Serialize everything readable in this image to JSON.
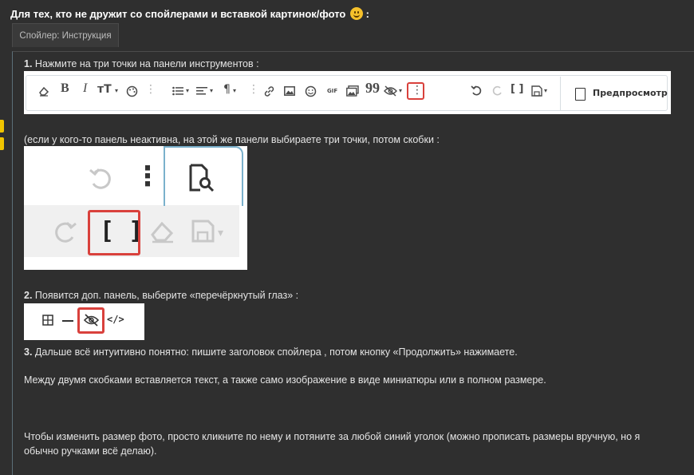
{
  "header": {
    "title": "Для тех, кто не дружит со спойлерами и вставкой картинок/фото",
    "title_suffix": ":"
  },
  "spoiler": {
    "label": "Спойлер: Инструкция"
  },
  "steps": {
    "step1_num": "1.",
    "step1_text": "Нажмите на три точки на панели инструментов :",
    "note_inactive": "(если у кого-то панель неактивна, на этой же панели выбираете три точки, потом скобки :",
    "step2_num": "2.",
    "step2_text": "Появится доп. панель, выберите «перечёркнутый глаз» :",
    "step3_num": "3.",
    "step3_text": "Дальше всё интуитивно понятно: пишите заголовок спойлера , потом кнопку «Продолжить» нажимаете.",
    "between_text": "Между двумя скобками вставляется текст, а также само изображение в виде миниатюры или в полном размере.",
    "resize_line1": "Чтобы изменить размер фото, просто кликните по нему и потяните за любой синий уголок (можно прописать размеры вручную, но я",
    "resize_line2": "обычно ручками всё делаю)."
  },
  "toolbar": {
    "bold": "B",
    "italic": "I",
    "text_size": "тT",
    "paragraph": "¶",
    "gif": "GIF",
    "quote": "99",
    "more_dots": "⋮",
    "brackets": "[ ]",
    "preview_label": "Предпросмотр"
  },
  "shot2": {
    "brackets": "[ ]",
    "more_dots": "⋮"
  },
  "shot3": {
    "code": "</>"
  },
  "colors": {
    "background": "#2f2f2f",
    "highlight_red": "#d9413c",
    "accent_yellow": "#f0c400"
  }
}
